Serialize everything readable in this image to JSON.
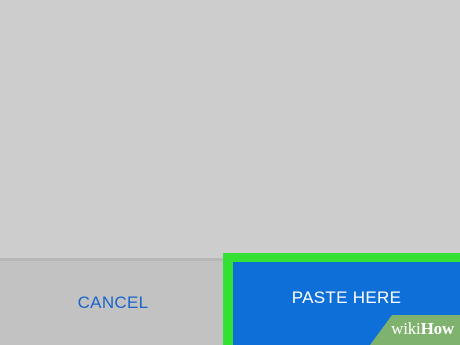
{
  "dialog": {
    "cancel_label": "CANCEL",
    "paste_label": "PASTE HERE"
  },
  "watermark": {
    "wiki": "wiki",
    "how": "How"
  },
  "colors": {
    "background": "#cdcdcd",
    "bottom_bar": "#c2c2c2",
    "cancel_text": "#1b64c9",
    "paste_button": "#0f6fd8",
    "highlight": "#33e033"
  }
}
